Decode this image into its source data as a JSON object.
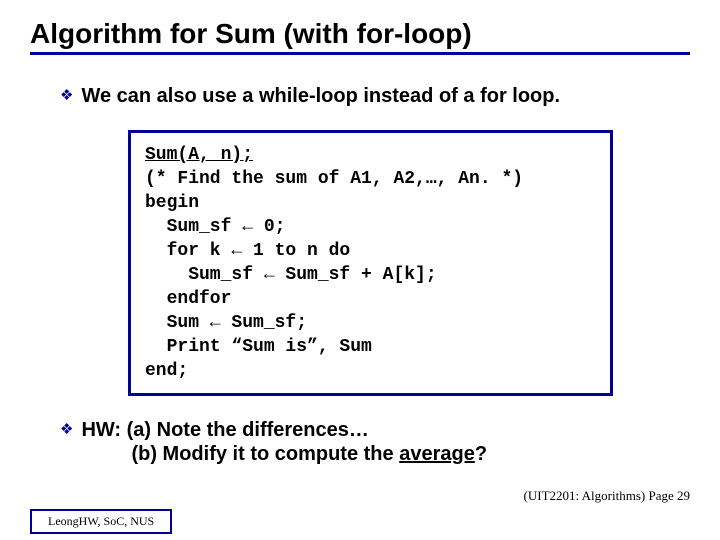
{
  "title": "Algorithm for Sum (with for-loop)",
  "bullets": {
    "b1": "We can also use a while-loop instead of a for loop.",
    "b2_prefix": "HW:  (a) Note the differences…",
    "b2_line2_pre": "         (b) Modify it to compute the ",
    "b2_line2_underlined": "average",
    "b2_line2_post": "?"
  },
  "code": {
    "sig": "Sum(A, n);",
    "l2": "(* Find the sum of A1, A2,…, An. *)",
    "l3": "begin",
    "l4": "  Sum_sf ← 0;",
    "l5": "  for k ← 1 to n do",
    "l6": "    Sum_sf ← Sum_sf + A[k];",
    "l7": "  endfor",
    "l8": "  Sum ← Sum_sf;",
    "l9": "  Print “Sum is”, Sum",
    "l10": "end;"
  },
  "page_ref": "(UIT2201: Algorithms) Page 29",
  "footer": "LeongHW, SoC, NUS"
}
